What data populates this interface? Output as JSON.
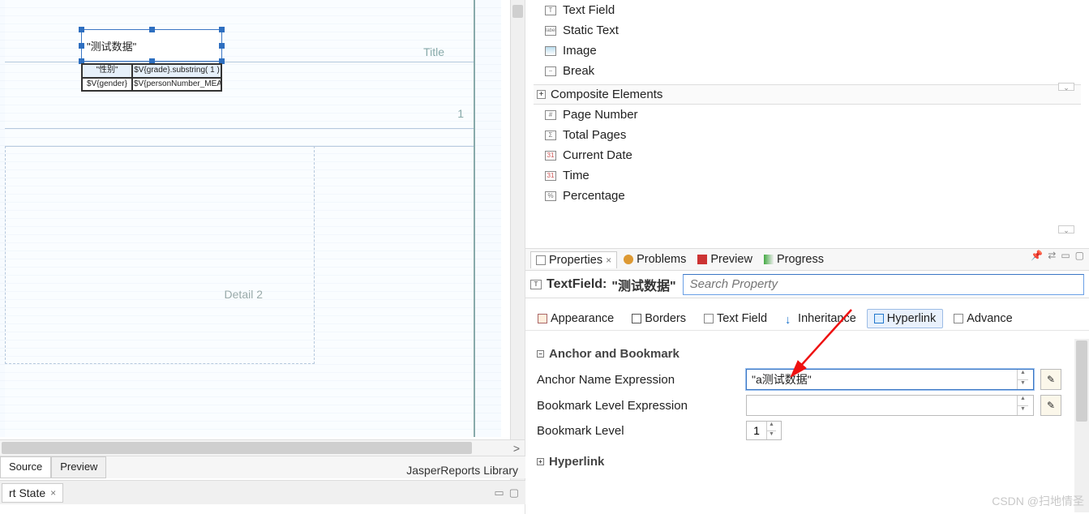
{
  "canvas": {
    "selected_text": "\"测试数据\"",
    "band_title": "Title",
    "band_d1": "1",
    "band_d2": "Detail 2",
    "table": {
      "r1c1": "\"性别\"",
      "r1c2": "$V{grade}.substring( 1 )",
      "r2c1": "$V{gender}",
      "r2c2": "$V{personNumber_MEASURE}"
    }
  },
  "bottom_tabs": {
    "source": "Source",
    "preview": "Preview"
  },
  "library_label": "JasperReports Library",
  "state_tab": "rt State",
  "palette": {
    "items_top": [
      "Text Field",
      "Static Text",
      "Image",
      "Break"
    ],
    "composite_header": "Composite Elements",
    "items_comp": [
      "Page Number",
      "Total Pages",
      "Current Date",
      "Time",
      "Percentage"
    ]
  },
  "views": {
    "properties": "Properties",
    "problems": "Problems",
    "preview": "Preview",
    "progress": "Progress"
  },
  "tf_header": {
    "label": "TextField:",
    "value": "\"测试数据\"",
    "search_placeholder": "Search Property"
  },
  "prop_tabs": {
    "appearance": "Appearance",
    "borders": "Borders",
    "text_field": "Text Field",
    "inheritance": "Inheritance",
    "hyperlink": "Hyperlink",
    "advanced": "Advance"
  },
  "sections": {
    "anchor": "Anchor and Bookmark",
    "hyperlink": "Hyperlink"
  },
  "props": {
    "anchor_name": {
      "label": "Anchor Name Expression",
      "value": "\"a测试数据\""
    },
    "bookmark_expr": {
      "label": "Bookmark Level Expression",
      "value": ""
    },
    "bookmark_level": {
      "label": "Bookmark Level",
      "value": "1"
    }
  },
  "watermark": "CSDN @扫地情圣"
}
